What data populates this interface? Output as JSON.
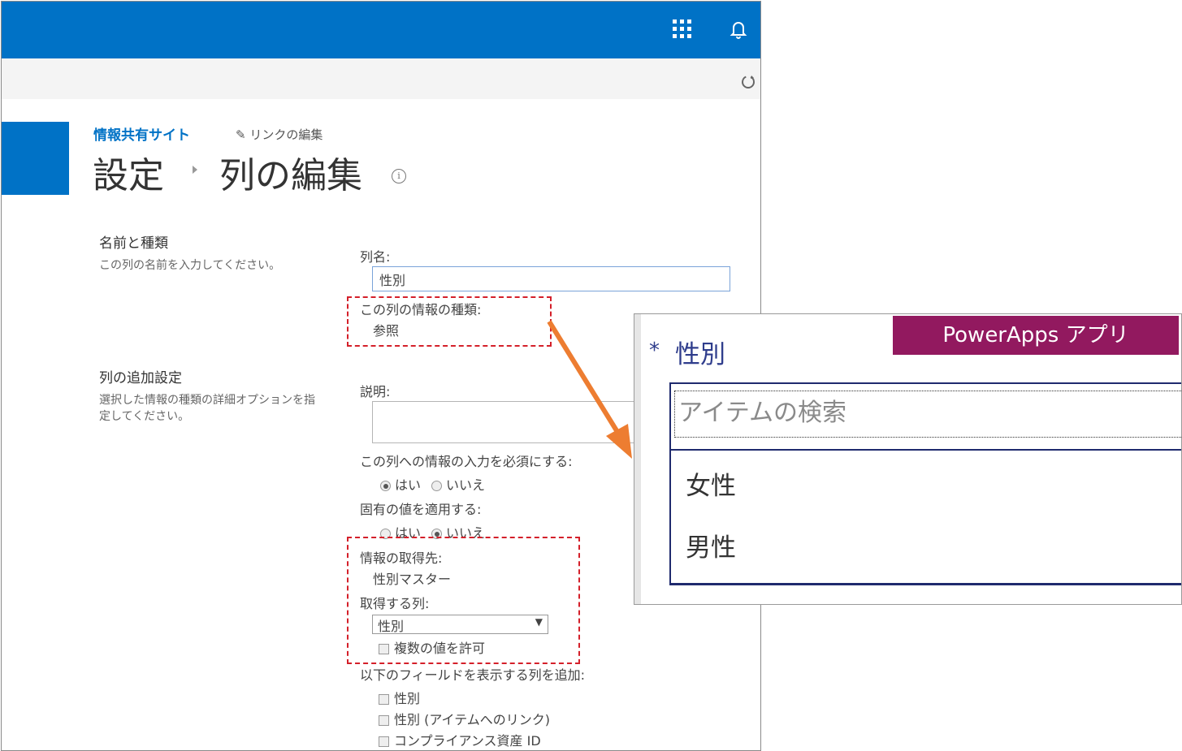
{
  "suite": {
    "apps_icon": "waffle-icon",
    "bell_icon": "bell-icon",
    "sync_icon": "sync-icon"
  },
  "header": {
    "site_name": "情報共有サイト",
    "edit_links": "リンクの編集",
    "breadcrumb_parent": "設定",
    "page_title": "列の編集",
    "info_icon": "i"
  },
  "section1": {
    "title": "名前と種類",
    "desc": "この列の名前を入力してください。",
    "column_name_label": "列名:",
    "column_name_value": "性別",
    "type_label": "この列の情報の種類:",
    "type_value": "参照"
  },
  "section2": {
    "title": "列の追加設定",
    "desc_line1": "選択した情報の種類の詳細オプションを指",
    "desc_line2": "定してください。",
    "description_label": "説明:",
    "required_label": "この列への情報の入力を必須にする:",
    "required_yes": "はい",
    "required_no": "いいえ",
    "unique_label": "固有の値を適用する:",
    "unique_yes": "はい",
    "unique_no": "いいえ",
    "source_label": "情報の取得先:",
    "source_value": "性別マスター",
    "get_column_label": "取得する列:",
    "get_column_value": "性別",
    "allow_multiple": "複数の値を許可",
    "add_columns_label": "以下のフィールドを表示する列を追加:",
    "add_col_1": "性別",
    "add_col_2": "性別 (アイテムへのリンク)",
    "add_col_3": "コンプライアンス資産 ID"
  },
  "powerapps": {
    "badge": "PowerApps アプリ",
    "required_mark": "*",
    "field_label": "性別",
    "search_placeholder": "アイテムの検索",
    "items": [
      "女性",
      "男性"
    ]
  },
  "colors": {
    "suite_blue": "#0072c6",
    "annotation_red": "#d4202a",
    "arrow_orange": "#ed7d31",
    "badge_purple": "#92195f",
    "powerapps_navy": "#2f3d8c"
  }
}
